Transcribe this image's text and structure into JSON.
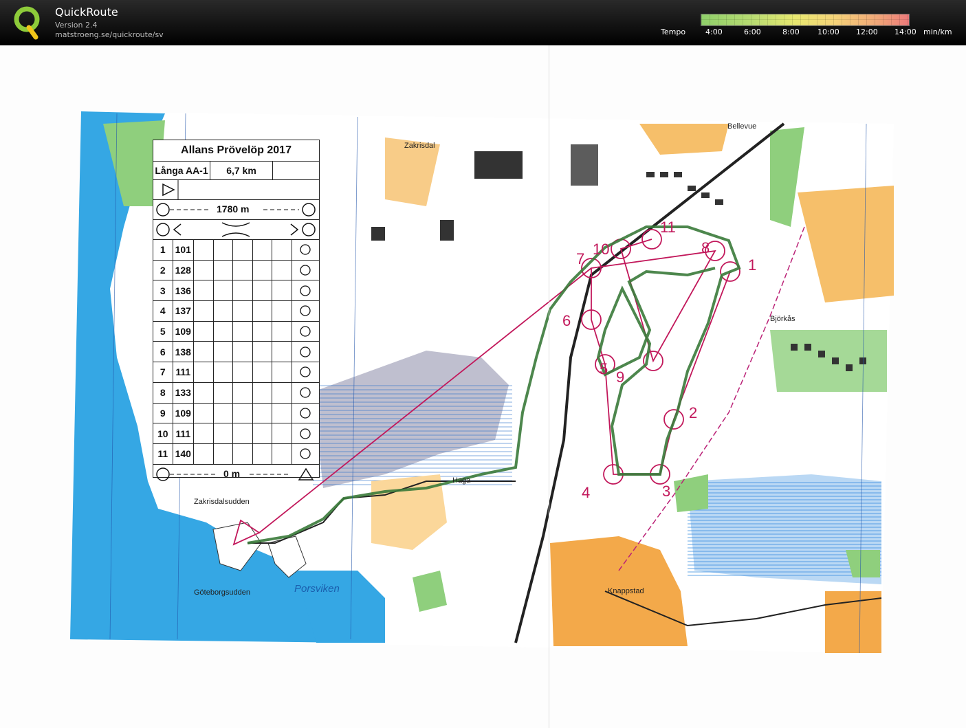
{
  "header": {
    "app_title": "QuickRoute",
    "version": "Version 2.4",
    "url": "matstroeng.se/quickroute/sv",
    "tempo_label": "Tempo",
    "tempo_ticks": [
      "4:00",
      "6:00",
      "8:00",
      "10:00",
      "12:00",
      "14:00"
    ],
    "tempo_unit": "min/km"
  },
  "description_sheet": {
    "title": "Allans Prövelöp 2017",
    "course": "Långa AA-1",
    "length": "6,7 km",
    "marked_route_1": "1780 m",
    "marked_route_end": "0 m",
    "controls": [
      {
        "num": "1",
        "code": "101"
      },
      {
        "num": "2",
        "code": "128"
      },
      {
        "num": "3",
        "code": "136"
      },
      {
        "num": "4",
        "code": "137"
      },
      {
        "num": "5",
        "code": "109"
      },
      {
        "num": "6",
        "code": "138"
      },
      {
        "num": "7",
        "code": "111"
      },
      {
        "num": "8",
        "code": "133"
      },
      {
        "num": "9",
        "code": "109"
      },
      {
        "num": "10",
        "code": "111"
      },
      {
        "num": "11",
        "code": "140"
      }
    ]
  },
  "map_labels": {
    "zakrisdal": "Zakrisdal",
    "bellevue": "Bellevue",
    "bjorkas": "Björkås",
    "haga": "Haga",
    "zakrisdalsudden": "Zakrisdalsudden",
    "goteborgsudden": "Göteborgsudden",
    "porsviken": "Porsviken",
    "knappstad": "Knappstad"
  },
  "control_numbers_on_map": [
    "1",
    "2",
    "3",
    "4",
    "5",
    "6",
    "7",
    "8",
    "9",
    "10",
    "11"
  ],
  "colors": {
    "water": "#33a4e0",
    "forest": "#ffffff",
    "open_land": "#f5b35a",
    "rough_open": "#fbd79a",
    "green_veg": "#9bd08c",
    "course_magenta": "#c2185b",
    "route_green": "#3a7a3a"
  }
}
